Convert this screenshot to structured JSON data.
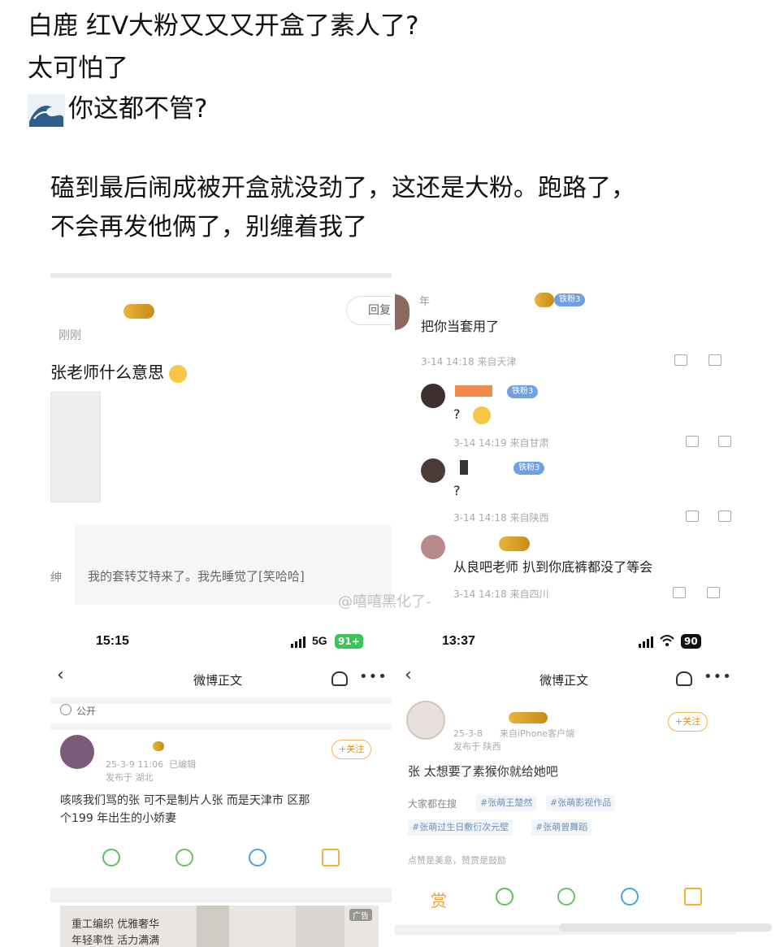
{
  "post": {
    "line1": "白鹿 红V大粉又又又开盒了素人了?",
    "line2": "太可怕了",
    "line3_icon": "wave-emoji-icon",
    "line3": "你这都不管?"
  },
  "quote": {
    "line1": "磕到最后闹成被开盒就没劲了，这还是大粉。跑路了，",
    "line2": "不会再发他俩了，别缠着我了"
  },
  "panel_top_left": {
    "time": "刚刚",
    "reply_btn": "回复",
    "comment": "张老师什么意思",
    "emoji": "smile-emoji-icon",
    "quoted": "我的套转艾特来了。我先睡觉了[笑哈哈]",
    "side_char": "绅"
  },
  "panel_top_right": {
    "comments": [
      {
        "text": "把你当套用了",
        "meta": "3-14 14:18 来自天津",
        "badge": "铁粉3"
      },
      {
        "text": "?",
        "meta": "3-14 14:19 来自甘肃",
        "badge": "铁粉3"
      },
      {
        "text": "?",
        "meta": "3-14 14:18 来自陕西",
        "badge": "铁粉3"
      },
      {
        "text": "从良吧老师 扒到你底裤都没了等会",
        "meta": "3-14 14:18 来自四川",
        "badge": ""
      }
    ],
    "name_prefix": "年"
  },
  "watermark": "@嘻嘻黑化了-",
  "screen_left": {
    "time": "15:15",
    "signal": "5G",
    "battery": "91+",
    "nav_title": "微博正文",
    "visibility": "公开",
    "date": "25-3-9 11:06",
    "edited": "已编辑",
    "location": "发布于 湖北",
    "follow": "+关注",
    "body_line1": "咳咳我们骂的张   可不是制片人张   而是天津市   区那",
    "body_line2": "个199    年出生的小娇妻",
    "ad_line1": "重工编织 优雅奢华",
    "ad_line2": "年轻率性 活力满满",
    "ad_label": "广告"
  },
  "screen_right": {
    "time": "13:37",
    "battery": "90",
    "nav_title": "微博正文",
    "date": "25-3-8",
    "source": "来自iPhone客户端",
    "location": "发布于 陕西",
    "follow": "+关注",
    "body": "张   太想要了素猴你就给她吧",
    "search_label": "大家都在搜",
    "tags": [
      "#张萌王楚然",
      "#张萌影视作品",
      "#张萌过生日敷衍次元壁",
      "#张萌曾舞蹈"
    ],
    "footer": "点赞是美意，赞赏是鼓励",
    "reward": "赏"
  },
  "colors": {
    "gold": "#e7b53b",
    "blue_badge": "#6fa0e6",
    "wechat": "#5bc25e",
    "moments": "#6bbf6b",
    "qq": "#4aa3df",
    "orange": "#f08a00"
  }
}
